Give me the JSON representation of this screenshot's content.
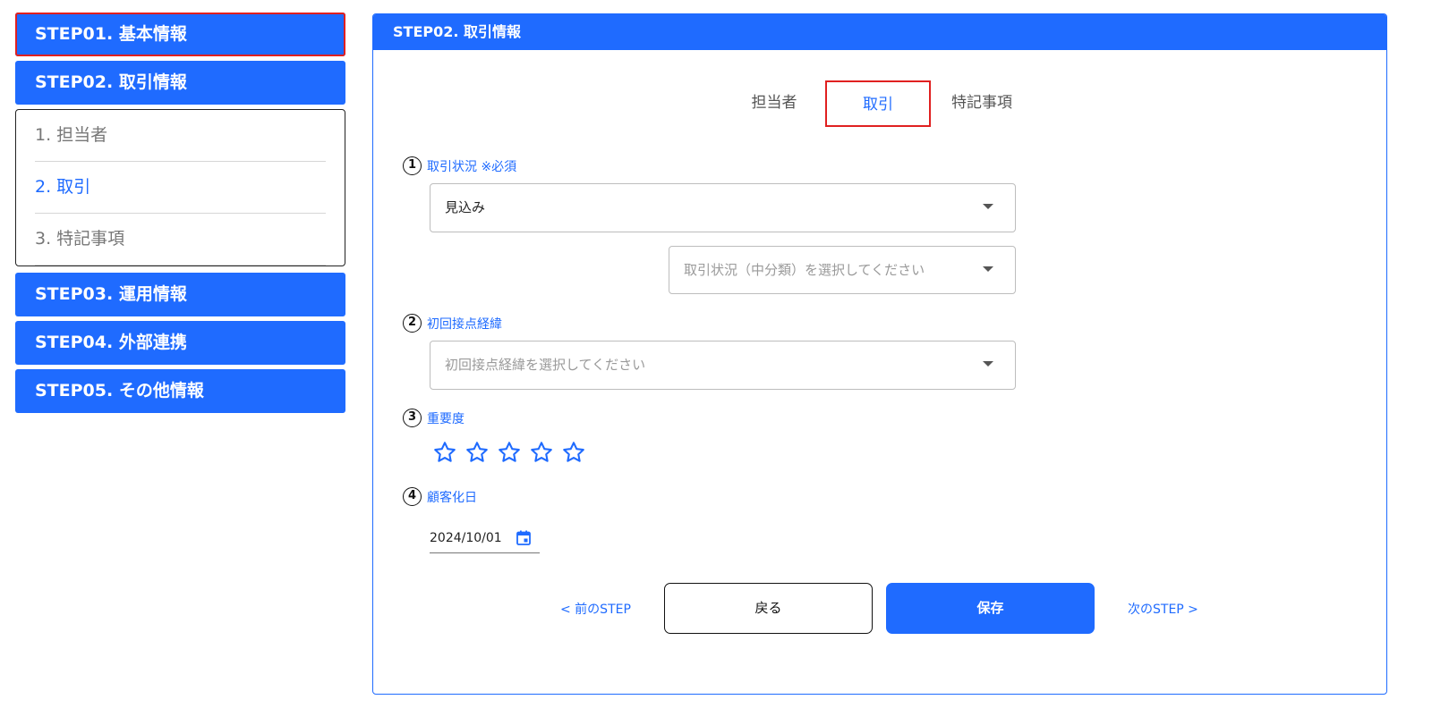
{
  "sidebar": {
    "steps": [
      {
        "label": "STEP01. 基本情報"
      },
      {
        "label": "STEP02. 取引情報"
      },
      {
        "label": "STEP03. 運用情報"
      },
      {
        "label": "STEP04. 外部連携"
      },
      {
        "label": "STEP05. その他情報"
      }
    ],
    "substeps": [
      {
        "label": "1. 担当者"
      },
      {
        "label": "2. 取引"
      },
      {
        "label": "3. 特記事項"
      }
    ]
  },
  "panel": {
    "title": "STEP02. 取引情報",
    "tabs": [
      {
        "label": "担当者"
      },
      {
        "label": "取引"
      },
      {
        "label": "特記事項"
      }
    ]
  },
  "fields": {
    "status": {
      "number": "1",
      "label": "取引状況 ※必須",
      "value": "見込み",
      "sub_placeholder": "取引状況（中分類）を選択してください"
    },
    "first_contact": {
      "number": "2",
      "label": "初回接点経緯",
      "placeholder": "初回接点経緯を選択してください"
    },
    "importance": {
      "number": "3",
      "label": "重要度",
      "rating": 0,
      "max": 5
    },
    "customer_date": {
      "number": "4",
      "label": "顧客化日",
      "value": "2024/10/01"
    }
  },
  "footer": {
    "prev_label": "< 前のSTEP",
    "back_label": "戻る",
    "save_label": "保存",
    "next_label": "次のSTEP >"
  },
  "colors": {
    "accent": "#1f6bff",
    "highlight": "#e02020"
  }
}
